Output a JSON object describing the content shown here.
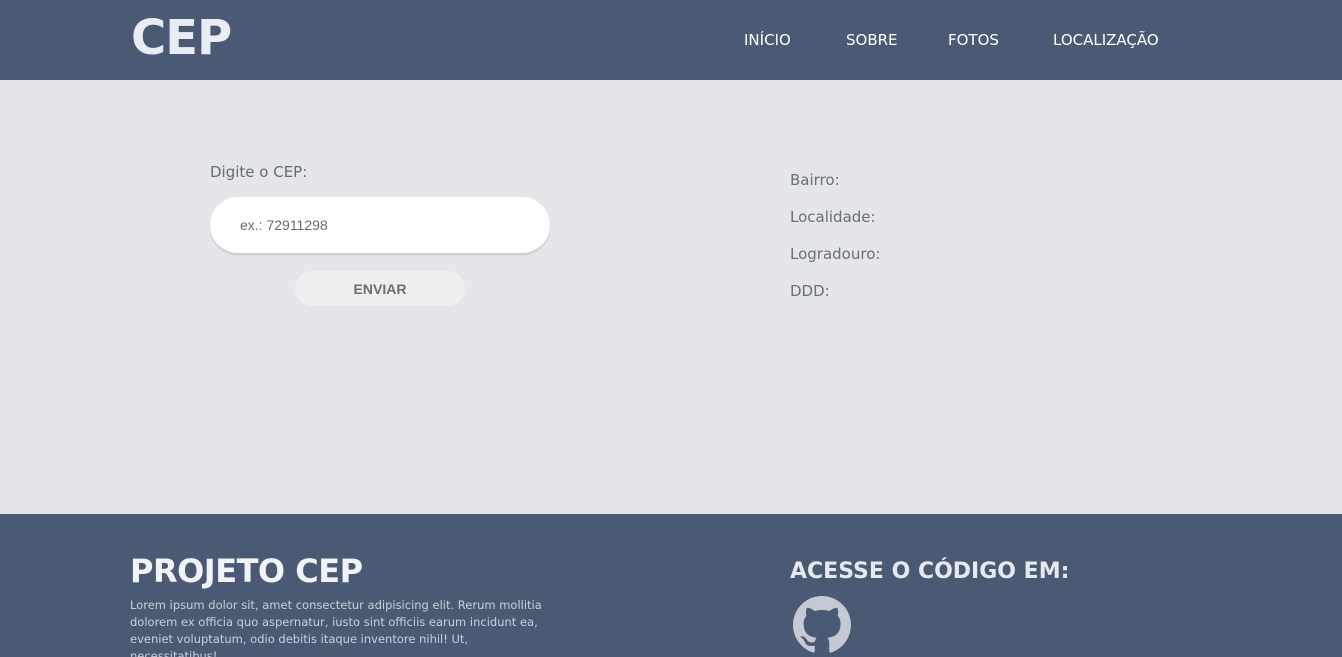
{
  "header": {
    "logo": "CEP",
    "nav": [
      "INÍCIO",
      "SOBRE",
      "FOTOS",
      "LOCALIZAÇÃO"
    ]
  },
  "form": {
    "label": "Digite o CEP:",
    "input_placeholder": "ex.: 72911298",
    "input_value": "",
    "button_label": "ENVIAR"
  },
  "results": {
    "bairro": "Bairro:",
    "localidade": "Localidade:",
    "logradouro": "Logradouro:",
    "ddd": "DDD:"
  },
  "footer": {
    "title": "PROJETO CEP",
    "text": "Lorem ipsum dolor sit, amet consectetur adipisicing elit. Rerum mollitia dolorem ex officia quo aspernatur, iusto sint officiis earum incidunt ea, eveniet voluptatum, odio debitis itaque inventore nihil! Ut, necessitatibus!",
    "access_title": "ACESSE O CÓDIGO EM:",
    "icon": "github-icon"
  },
  "colors": {
    "header_bg": "#4b5a74",
    "main_bg": "#e5e6ea",
    "footer_bg": "#4b5a74"
  }
}
